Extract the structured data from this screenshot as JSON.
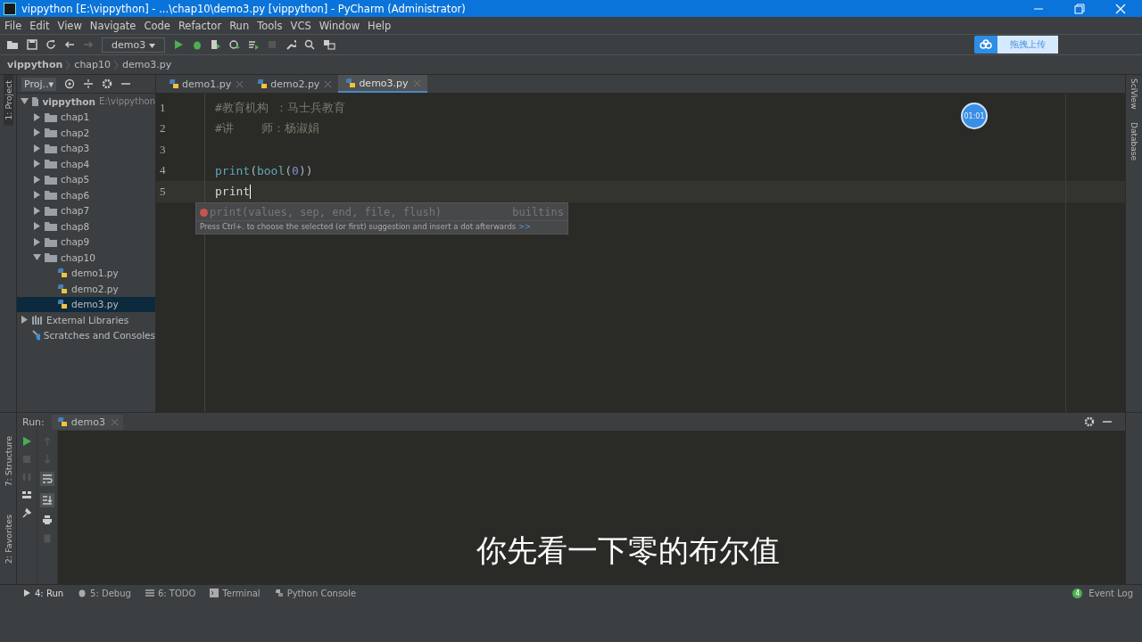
{
  "window": {
    "title": "vippython [E:\\vippython] - ...\\chap10\\demo3.py [vippython] - PyCharm (Administrator)"
  },
  "menu": [
    "File",
    "Edit",
    "View",
    "Navigate",
    "Code",
    "Refactor",
    "Run",
    "Tools",
    "VCS",
    "Window",
    "Help"
  ],
  "toolbar": {
    "run_config": "demo3"
  },
  "upload_button": {
    "label": "拖拽上传"
  },
  "breadcrumbs": [
    "vippython",
    "chap10",
    "demo3.py"
  ],
  "left_stripe": [
    "1: Project",
    "7: Structure",
    "2: Favorites"
  ],
  "right_stripe": [
    "SciView",
    "Database"
  ],
  "project": {
    "header": "Proj..▾",
    "tree": [
      {
        "kind": "root",
        "label": "vippython",
        "path": "E:\\vippython",
        "expanded": true,
        "selected": false,
        "children": [
          {
            "kind": "folder",
            "label": "chap1",
            "expanded": false,
            "selected": false
          },
          {
            "kind": "folder",
            "label": "chap2",
            "expanded": false,
            "selected": false
          },
          {
            "kind": "folder",
            "label": "chap3",
            "expanded": false,
            "selected": false
          },
          {
            "kind": "folder",
            "label": "chap4",
            "expanded": false,
            "selected": false
          },
          {
            "kind": "folder",
            "label": "chap5",
            "expanded": false,
            "selected": false
          },
          {
            "kind": "folder",
            "label": "chap6",
            "expanded": false,
            "selected": false
          },
          {
            "kind": "folder",
            "label": "chap7",
            "expanded": false,
            "selected": false
          },
          {
            "kind": "folder",
            "label": "chap8",
            "expanded": false,
            "selected": false
          },
          {
            "kind": "folder",
            "label": "chap9",
            "expanded": false,
            "selected": false
          },
          {
            "kind": "folder",
            "label": "chap10",
            "expanded": true,
            "selected": false,
            "children": [
              {
                "kind": "file",
                "label": "demo1.py",
                "selected": false
              },
              {
                "kind": "file",
                "label": "demo2.py",
                "selected": false
              },
              {
                "kind": "file",
                "label": "demo3.py",
                "selected": true
              }
            ]
          }
        ]
      },
      {
        "kind": "library",
        "label": "External Libraries",
        "expanded": false,
        "selected": false
      },
      {
        "kind": "scratches",
        "label": "Scratches and Consoles",
        "selected": false
      }
    ]
  },
  "editor": {
    "tabs": [
      {
        "label": "demo1.py",
        "selected": false
      },
      {
        "label": "demo2.py",
        "selected": false
      },
      {
        "label": "demo3.py",
        "selected": true
      }
    ],
    "lines": [
      {
        "number": "1",
        "current": false,
        "tokens": [
          {
            "kind": "comment",
            "text": "#教育机构 ：马士兵教育"
          }
        ]
      },
      {
        "number": "2",
        "current": false,
        "tokens": [
          {
            "kind": "comment",
            "text": "#讲    师：杨淑娟"
          }
        ]
      },
      {
        "number": "3",
        "current": false
      },
      {
        "number": "4",
        "current": false,
        "tokens": [
          {
            "kind": "builtin",
            "text": "print"
          },
          {
            "kind": "paren",
            "text": "("
          },
          {
            "kind": "builtin",
            "text": "bool"
          },
          {
            "kind": "paren",
            "text": "("
          },
          {
            "kind": "number",
            "text": "0"
          },
          {
            "kind": "paren",
            "text": "))"
          }
        ]
      },
      {
        "number": "5",
        "current": true,
        "tokens": [
          {
            "kind": "plain",
            "text": "print"
          }
        ]
      }
    ],
    "completion": {
      "signature": "print(values, sep, end, file, flush)",
      "source": "builtins",
      "hint": "Press Ctrl+. to choose the selected (or first) suggestion and insert a dot afterwards",
      "hint_link": ">>"
    },
    "timer": "01:01"
  },
  "run_panel": {
    "label": "Run:",
    "tab": "demo3"
  },
  "bottom_tabs": [
    "4: Run",
    "5: Debug",
    "6: TODO",
    "Terminal",
    "Python Console"
  ],
  "event_log": {
    "count": "4",
    "label": "Event Log"
  },
  "subtitle": "你先看一下零的布尔值"
}
